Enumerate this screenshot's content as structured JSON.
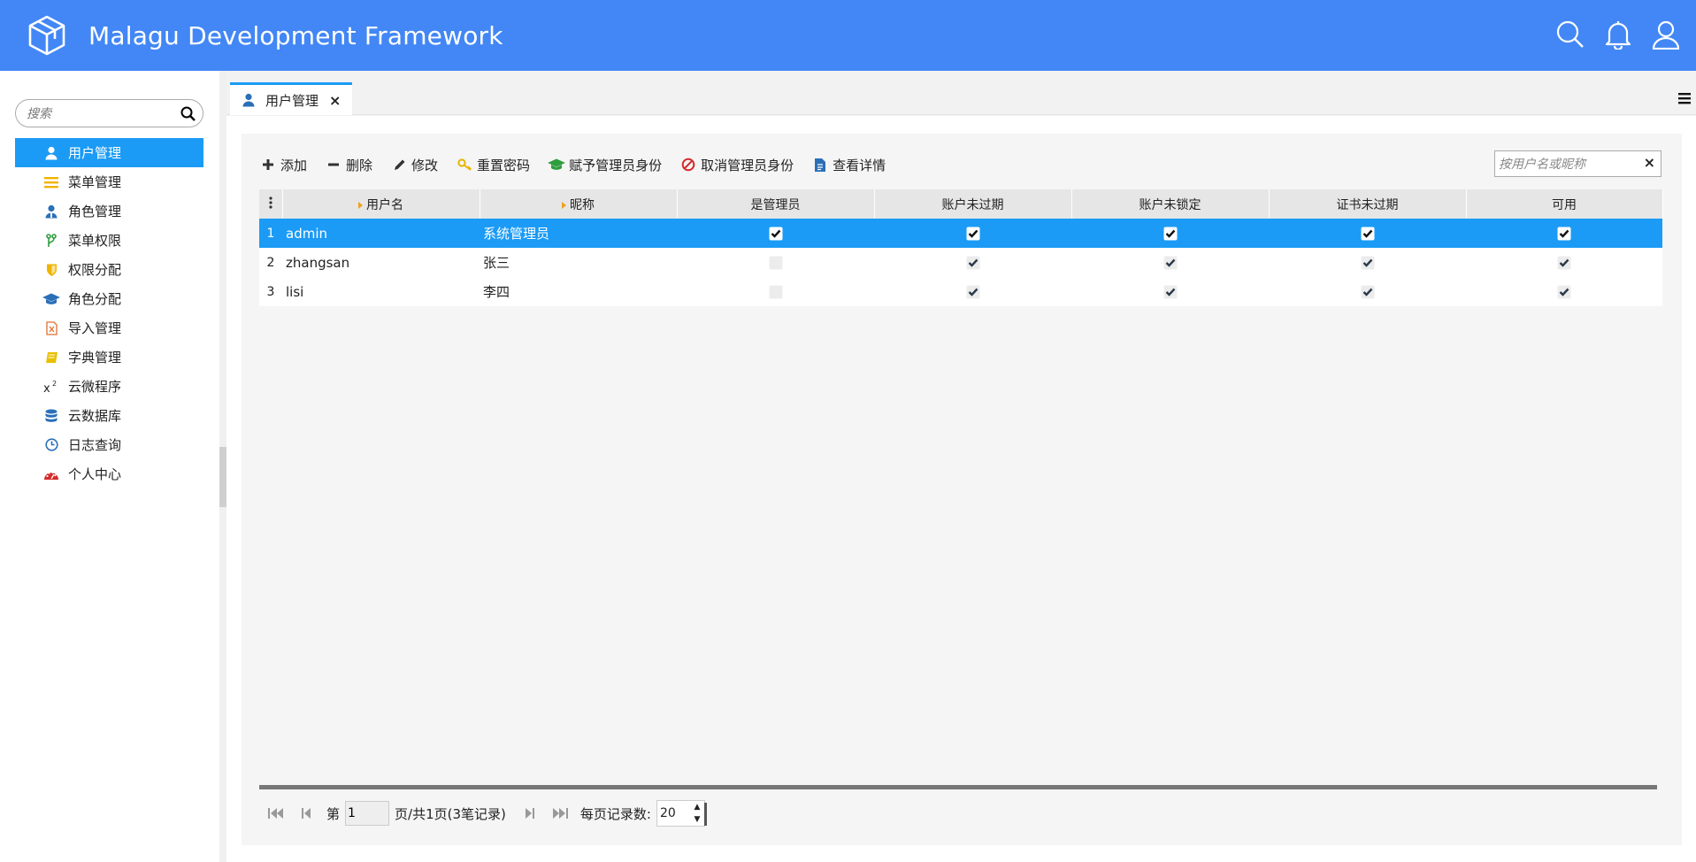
{
  "app": {
    "title": "Malagu Development Framework"
  },
  "header": {
    "icons": [
      "search-icon",
      "bell-icon",
      "user-icon"
    ]
  },
  "sidebar": {
    "search_placeholder": "搜索",
    "items": [
      {
        "label": "用户管理",
        "icon": "user-icon",
        "active": true
      },
      {
        "label": "菜单管理",
        "icon": "list-icon"
      },
      {
        "label": "角色管理",
        "icon": "role-icon"
      },
      {
        "label": "菜单权限",
        "icon": "branch-icon"
      },
      {
        "label": "权限分配",
        "icon": "shield-icon"
      },
      {
        "label": "角色分配",
        "icon": "graduation-cap-icon"
      },
      {
        "label": "导入管理",
        "icon": "excel-file-icon"
      },
      {
        "label": "字典管理",
        "icon": "book-icon"
      },
      {
        "label": "云微程序",
        "icon": "superscript-icon"
      },
      {
        "label": "云数据库",
        "icon": "database-icon"
      },
      {
        "label": "日志查询",
        "icon": "clock-icon"
      },
      {
        "label": "个人中心",
        "icon": "dashboard-icon"
      }
    ]
  },
  "tabs": [
    {
      "label": "用户管理",
      "close": "×"
    }
  ],
  "toolbar": {
    "add": "添加",
    "delete": "删除",
    "edit": "修改",
    "reset_password": "重置密码",
    "grant_admin": "赋予管理员身份",
    "revoke_admin": "取消管理员身份",
    "view_details": "查看详情",
    "filter_placeholder": "按用户名或昵称",
    "filter_clear": "×"
  },
  "table": {
    "columns": [
      "用户名",
      "昵称",
      "是管理员",
      "账户未过期",
      "账户未锁定",
      "证书未过期",
      "可用"
    ],
    "rows": [
      {
        "no": "1",
        "username": "admin",
        "nickname": "系统管理员",
        "is_admin": true,
        "not_expired": true,
        "not_locked": true,
        "cred_not_expired": true,
        "enabled": true
      },
      {
        "no": "2",
        "username": "zhangsan",
        "nickname": "张三",
        "is_admin": false,
        "not_expired": true,
        "not_locked": true,
        "cred_not_expired": true,
        "enabled": true
      },
      {
        "no": "3",
        "username": "lisi",
        "nickname": "李四",
        "is_admin": false,
        "not_expired": true,
        "not_locked": true,
        "cred_not_expired": true,
        "enabled": true
      }
    ]
  },
  "pager": {
    "page_prefix": "第",
    "page_value": "1",
    "page_suffix": "页/共1页(3笔记录)",
    "page_size_label": "每页记录数:",
    "page_size": "20"
  },
  "colors": {
    "header": "#4287f5",
    "selected": "#1b9bf5",
    "accent_arrow": "#f0a020"
  }
}
